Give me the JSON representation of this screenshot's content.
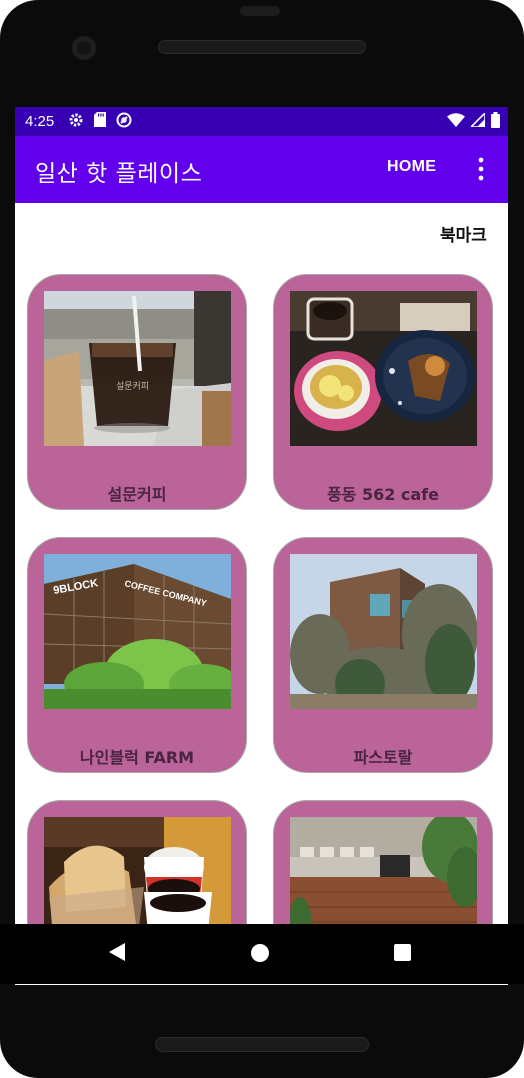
{
  "status_bar": {
    "time": "4:25",
    "left_icons": [
      "settings-icon",
      "sd-card-icon",
      "vpn-icon"
    ],
    "right_icons": [
      "wifi-icon",
      "signal-icon",
      "battery-icon"
    ]
  },
  "app_bar": {
    "title": "일산 핫 플레이스",
    "home_label": "HOME",
    "overflow_icon": "more-vert-icon",
    "color": "#6200ee"
  },
  "colors": {
    "status_bar": "#3700b3",
    "card": "#bb6499",
    "card_label": "#4a2540"
  },
  "bookmark_label": "북마크",
  "cards": [
    {
      "label": "설문커피"
    },
    {
      "label": "풍동 562 cafe"
    },
    {
      "label": "나인블럭 FARM"
    },
    {
      "label": "파스토랄"
    },
    {
      "label": ""
    },
    {
      "label": ""
    }
  ],
  "photo_text": {
    "block_sign": "9BLOCK",
    "coffee_sign": "COFFEE COMPANY"
  },
  "nav": {
    "back_icon": "back-triangle-icon",
    "home_icon": "home-circle-icon",
    "recents_icon": "recents-square-icon"
  }
}
